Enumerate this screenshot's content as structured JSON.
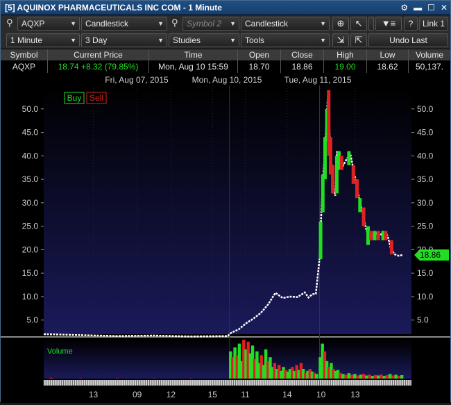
{
  "window": {
    "title": "[5] AQUINOX PHARMACEUTICALS INC COM - 1 Minute",
    "icons": [
      "gear-icon",
      "minimize-icon",
      "maximize-icon",
      "close-icon"
    ]
  },
  "toolbar1": {
    "symbol": "AQXP",
    "chart_type": "Candlestick",
    "symbol2_placeholder": "Symbol 2",
    "chart_type2": "Candlestick",
    "help_label": "?",
    "link_label": "Link 1"
  },
  "toolbar2": {
    "interval": "1 Minute",
    "range": "3 Day",
    "studies": "Studies",
    "tools": "Tools",
    "undo_label": "Undo Last"
  },
  "quote": {
    "headers": [
      "Symbol",
      "Current Price",
      "Time",
      "Open",
      "Close",
      "High",
      "Low",
      "Volume"
    ],
    "symbol": "AQXP",
    "price": "18.74",
    "change": "+8.32 (79.85%)",
    "time": "Mon, Aug 10  15:59",
    "open": "18.70",
    "close": "18.86",
    "high": "19.00",
    "low": "18.62",
    "volume": "50,137."
  },
  "colors": {
    "up": "#22dd22",
    "down": "#dd2222",
    "line": "#ffffff",
    "plot_bg_top": "#000000",
    "plot_bg_bottom": "#1a1a5a",
    "accent_green": "#22dd22"
  },
  "chart_data": {
    "type": "candlestick",
    "date_labels": [
      "Fri, Aug 07, 2015",
      "Mon, Aug 10, 2015",
      "Tue, Aug 11, 2015"
    ],
    "buy_label": "Buy",
    "sell_label": "Sell",
    "volume_label": "Volume",
    "price_badge": "18.86",
    "ylim": [
      2.0,
      55.0
    ],
    "yticks": [
      5.0,
      10.0,
      15.0,
      20.0,
      25.0,
      30.0,
      35.0,
      40.0,
      45.0,
      50.0
    ],
    "ytick_labels": [
      "5.0",
      "10.0",
      "15.0",
      "20.0",
      "25.0",
      "30.0",
      "35.0",
      "40.0",
      "45.0",
      "50.0"
    ],
    "xtick_labels": [
      "13",
      "09",
      "12",
      "15",
      "11",
      "14",
      "10",
      "13"
    ],
    "xlim": [
      0,
      100
    ],
    "xtick_positions": [
      13.5,
      25.4,
      34.6,
      45.9,
      54.8,
      66.2,
      75.4,
      84.7
    ],
    "session_boundaries": [
      50.5,
      75.0
    ],
    "price_path": [
      [
        0,
        2.0
      ],
      [
        10,
        1.8
      ],
      [
        20,
        1.6
      ],
      [
        30,
        1.7
      ],
      [
        40,
        1.5
      ],
      [
        50,
        1.6
      ],
      [
        51,
        2.3
      ],
      [
        53,
        3.0
      ],
      [
        55,
        4.3
      ],
      [
        57,
        5.3
      ],
      [
        59,
        6.5
      ],
      [
        61,
        8.3
      ],
      [
        63,
        10.8
      ],
      [
        65,
        9.7
      ],
      [
        67,
        10.0
      ],
      [
        69,
        9.9
      ],
      [
        71,
        10.9
      ],
      [
        72,
        9.8
      ],
      [
        73,
        10.5
      ],
      [
        74,
        10.6
      ],
      [
        75,
        18.0
      ],
      [
        75.6,
        30.0
      ],
      [
        76.2,
        38.0
      ],
      [
        76.8,
        46.0
      ],
      [
        77.3,
        53.0
      ],
      [
        77.8,
        44.0
      ],
      [
        78.3,
        38.0
      ],
      [
        78.8,
        33.0
      ],
      [
        79.3,
        31.5
      ],
      [
        79.8,
        41.0
      ],
      [
        80.5,
        39.0
      ],
      [
        81.5,
        38.0
      ],
      [
        82.5,
        39.5
      ],
      [
        83.5,
        40.0
      ],
      [
        84.5,
        36.0
      ],
      [
        85.5,
        32.0
      ],
      [
        86.5,
        28.5
      ],
      [
        87.5,
        25.0
      ],
      [
        88.5,
        22.0
      ],
      [
        89.5,
        23.0
      ],
      [
        90.5,
        23.5
      ],
      [
        91.5,
        23.0
      ],
      [
        92.5,
        24.0
      ],
      [
        93.5,
        23.0
      ],
      [
        94.5,
        20.0
      ],
      [
        95.5,
        19.0
      ],
      [
        96.5,
        18.7
      ],
      [
        97.5,
        18.86
      ]
    ],
    "green_candles": [
      [
        75.3,
        18,
        26
      ],
      [
        75.9,
        28,
        36
      ],
      [
        76.5,
        35,
        44
      ],
      [
        77.0,
        43,
        50
      ],
      [
        79.7,
        32,
        40
      ],
      [
        80.3,
        37,
        41
      ],
      [
        83.0,
        38,
        41
      ],
      [
        86.0,
        28,
        31
      ],
      [
        88.2,
        21,
        25
      ],
      [
        90.0,
        22,
        24
      ],
      [
        92.3,
        22,
        24
      ]
    ],
    "red_candles": [
      [
        77.5,
        40,
        54
      ],
      [
        78.0,
        36,
        44
      ],
      [
        78.6,
        32,
        38
      ],
      [
        81.0,
        37,
        40
      ],
      [
        84.2,
        34,
        38
      ],
      [
        85.2,
        31,
        35
      ],
      [
        87.0,
        25,
        29
      ],
      [
        89.0,
        22,
        24
      ],
      [
        91.0,
        22,
        24
      ],
      [
        93.0,
        22,
        24
      ],
      [
        94.6,
        19,
        22
      ]
    ],
    "volume": {
      "ylim": [
        0,
        100
      ],
      "bars": [
        [
          2,
          2,
          0
        ],
        [
          10,
          1,
          0
        ],
        [
          20,
          1,
          0
        ],
        [
          30,
          1,
          0
        ],
        [
          40,
          1,
          0
        ],
        [
          50.8,
          70,
          1
        ],
        [
          51.4,
          55,
          0
        ],
        [
          52.0,
          80,
          1
        ],
        [
          52.6,
          60,
          0
        ],
        [
          53.2,
          90,
          1
        ],
        [
          53.8,
          45,
          1
        ],
        [
          54.4,
          100,
          0
        ],
        [
          55.0,
          75,
          1
        ],
        [
          55.6,
          95,
          0
        ],
        [
          56.2,
          65,
          1
        ],
        [
          56.8,
          85,
          1
        ],
        [
          57.4,
          50,
          0
        ],
        [
          58.0,
          70,
          1
        ],
        [
          58.6,
          40,
          1
        ],
        [
          59.2,
          60,
          0
        ],
        [
          59.8,
          35,
          1
        ],
        [
          60.4,
          75,
          1
        ],
        [
          61.0,
          45,
          0
        ],
        [
          61.6,
          55,
          1
        ],
        [
          62.2,
          30,
          1
        ],
        [
          62.8,
          40,
          0
        ],
        [
          63.4,
          25,
          1
        ],
        [
          64.0,
          35,
          0
        ],
        [
          64.6,
          20,
          1
        ],
        [
          65.2,
          30,
          1
        ],
        [
          65.8,
          22,
          0
        ],
        [
          66.4,
          18,
          1
        ],
        [
          67.0,
          25,
          1
        ],
        [
          67.6,
          30,
          0
        ],
        [
          68.2,
          20,
          1
        ],
        [
          68.8,
          35,
          0
        ],
        [
          69.4,
          22,
          1
        ],
        [
          70.0,
          40,
          0
        ],
        [
          70.6,
          25,
          1
        ],
        [
          71.2,
          15,
          0
        ],
        [
          71.8,
          20,
          1
        ],
        [
          72.4,
          25,
          0
        ],
        [
          73.0,
          18,
          1
        ],
        [
          73.6,
          15,
          0
        ],
        [
          74.2,
          12,
          1
        ],
        [
          75.2,
          55,
          1
        ],
        [
          75.8,
          90,
          1
        ],
        [
          76.4,
          70,
          0
        ],
        [
          77.0,
          45,
          1
        ],
        [
          77.6,
          30,
          0
        ],
        [
          78.2,
          40,
          1
        ],
        [
          78.8,
          25,
          0
        ],
        [
          79.4,
          20,
          1
        ],
        [
          80.0,
          22,
          1
        ],
        [
          80.6,
          15,
          0
        ],
        [
          81.4,
          12,
          1
        ],
        [
          82.2,
          10,
          0
        ],
        [
          83.0,
          14,
          1
        ],
        [
          83.8,
          10,
          0
        ],
        [
          84.6,
          12,
          1
        ],
        [
          85.4,
          8,
          0
        ],
        [
          86.2,
          10,
          1
        ],
        [
          87.0,
          12,
          0
        ],
        [
          87.8,
          8,
          1
        ],
        [
          88.6,
          10,
          0
        ],
        [
          89.4,
          7,
          1
        ],
        [
          90.2,
          9,
          0
        ],
        [
          91.0,
          8,
          1
        ],
        [
          91.8,
          10,
          0
        ],
        [
          92.6,
          7,
          1
        ],
        [
          93.4,
          9,
          0
        ],
        [
          94.2,
          12,
          1
        ],
        [
          95.0,
          8,
          0
        ],
        [
          95.8,
          10,
          1
        ],
        [
          96.6,
          7,
          0
        ],
        [
          97.4,
          9,
          1
        ]
      ]
    }
  }
}
